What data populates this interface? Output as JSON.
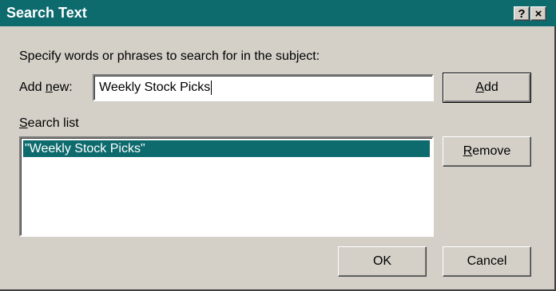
{
  "window": {
    "title": "Search Text",
    "help_button": "?",
    "close_button": "×"
  },
  "instruction": "Specify words or phrases to search for in the subject:",
  "add_new": {
    "label_prefix": "Add ",
    "label_accel": "n",
    "label_suffix": "ew:",
    "value": "Weekly Stock Picks"
  },
  "search_list": {
    "label_accel": "S",
    "label_suffix": "earch list",
    "items": [
      "\"Weekly Stock Picks\""
    ],
    "selected_index": 0
  },
  "buttons": {
    "add_accel": "A",
    "add_rest": "dd",
    "remove_accel": "R",
    "remove_rest": "emove",
    "ok": "OK",
    "cancel": "Cancel"
  },
  "colors": {
    "titlebar": "#0d6a6d",
    "selection": "#0d6a6d",
    "dialog_face": "#d4d0c8"
  }
}
